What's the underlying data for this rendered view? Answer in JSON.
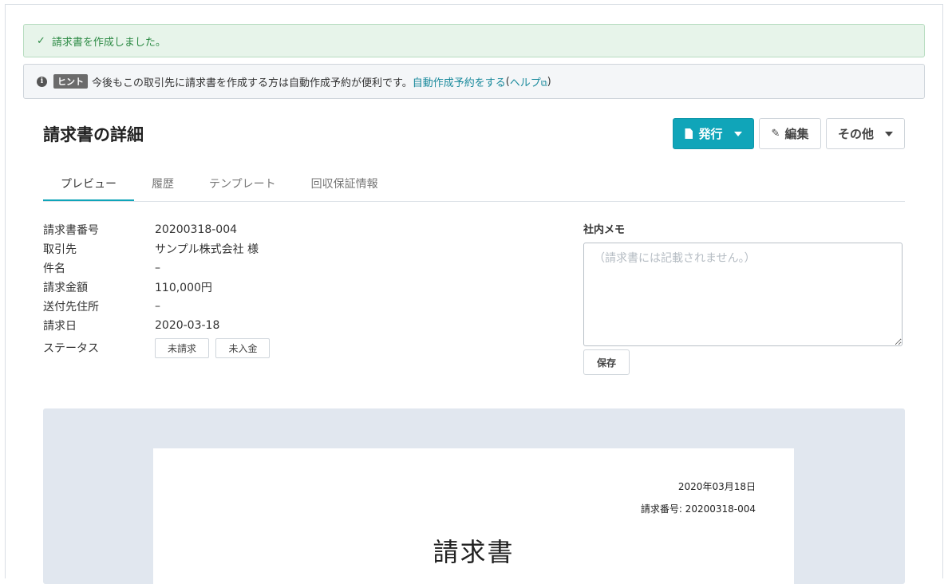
{
  "success_alert": {
    "text": "請求書を作成しました。"
  },
  "hint_alert": {
    "badge": "ヒント",
    "text": "今後もこの取引先に請求書を作成する方は自動作成予約が便利です。",
    "link_text": "自動作成予約をする",
    "help_open": "(",
    "help_text": "ヘルプ",
    "help_close": ")"
  },
  "page": {
    "title": "請求書の詳細"
  },
  "actions": {
    "issue_label": "発行",
    "edit_label": "編集",
    "other_label": "その他"
  },
  "tabs": [
    {
      "label": "プレビュー",
      "active": true
    },
    {
      "label": "履歴",
      "active": false
    },
    {
      "label": "テンプレート",
      "active": false
    },
    {
      "label": "回収保証情報",
      "active": false
    }
  ],
  "details": {
    "invoice_number": {
      "label": "請求書番号",
      "value": "20200318-004"
    },
    "client": {
      "label": "取引先",
      "value": "サンプル株式会社 様"
    },
    "subject": {
      "label": "件名",
      "value": "–"
    },
    "amount": {
      "label": "請求金額",
      "value": "110,000円"
    },
    "address": {
      "label": "送付先住所",
      "value": "–"
    },
    "date": {
      "label": "請求日",
      "value": "2020-03-18"
    },
    "status": {
      "label": "ステータス",
      "tags": [
        "未請求",
        "未入金"
      ]
    }
  },
  "memo": {
    "label": "社内メモ",
    "placeholder": "（請求書には記載されません。）",
    "save_label": "保存"
  },
  "preview": {
    "date": "2020年03月18日",
    "invoice_number": "請求番号: 20200318-004",
    "title": "請求書"
  },
  "colors": {
    "accent": "#10a5b9",
    "success_bg": "#e7f4ea",
    "success_text": "#2e8b46",
    "link": "#1a8a9c",
    "preview_bg": "#e1e7ef"
  }
}
